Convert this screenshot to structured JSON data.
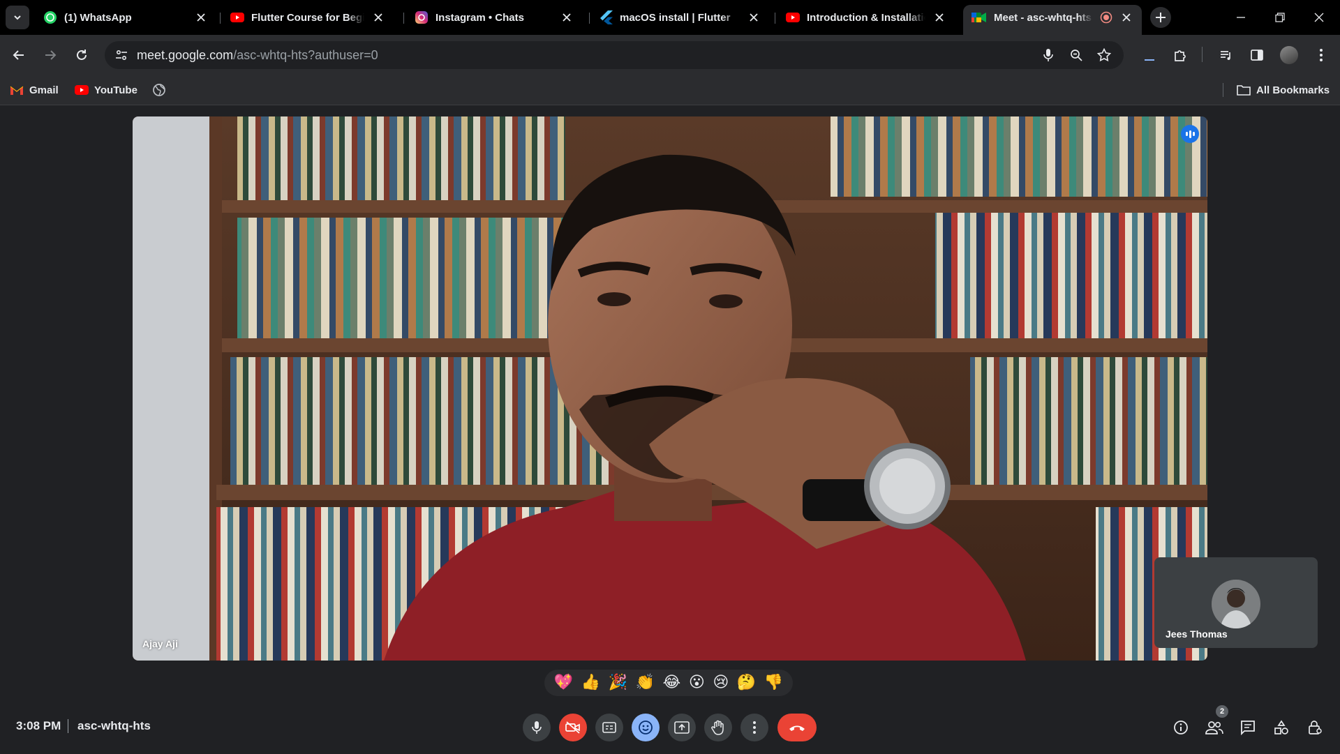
{
  "browser": {
    "tabs": [
      {
        "title": "(1) WhatsApp",
        "favicon": "whatsapp-icon",
        "active": false
      },
      {
        "title": "Flutter Course for Beginne",
        "favicon": "youtube-icon",
        "active": false
      },
      {
        "title": "Instagram • Chats",
        "favicon": "instagram-icon",
        "active": false
      },
      {
        "title": "macOS install | Flutter",
        "favicon": "flutter-icon",
        "active": false
      },
      {
        "title": "Introduction & Installation",
        "favicon": "youtube-icon",
        "active": false
      },
      {
        "title": "Meet - asc-whtq-hts",
        "favicon": "google-meet-icon",
        "active": true
      }
    ],
    "address": {
      "host": "meet.google.com",
      "path": "/asc-whtq-hts?authuser=0"
    },
    "bookmarks": [
      {
        "label": "Gmail",
        "icon": "gmail-icon"
      },
      {
        "label": "YouTube",
        "icon": "youtube-icon"
      }
    ],
    "all_bookmarks_label": "All Bookmarks"
  },
  "meet": {
    "main_participant": {
      "name": "Ajay Aji"
    },
    "self_tile": {
      "name": "Jees Thomas"
    },
    "reactions": [
      "💖",
      "👍",
      "🎉",
      "👏",
      "😂",
      "😮",
      "😢",
      "🤔",
      "👎"
    ],
    "time": "3:08 PM",
    "meeting_code": "asc-whtq-hts",
    "participant_count": "2",
    "colors": {
      "background": "#202124",
      "hangup": "#ea4335",
      "accent": "#8ab4f8",
      "speaking_indicator": "#1a73e8"
    }
  }
}
